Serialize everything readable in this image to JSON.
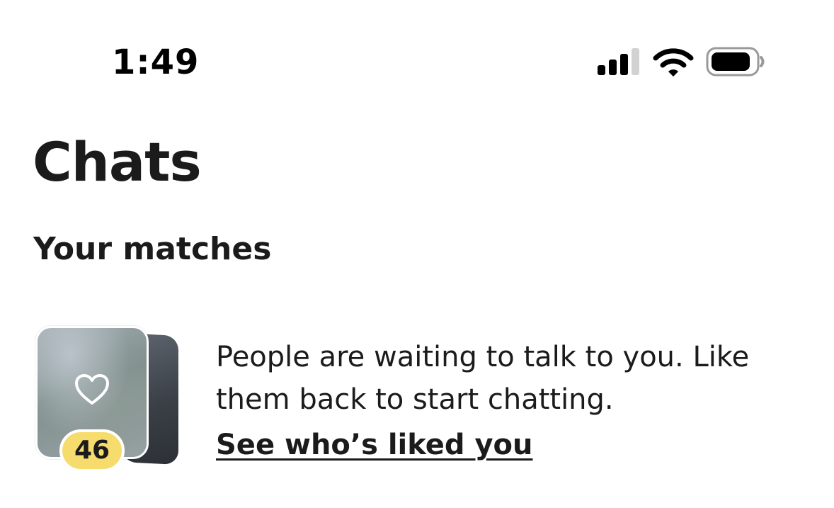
{
  "status_bar": {
    "time": "1:49",
    "signal_bars_filled": 3,
    "signal_bars_total": 4,
    "wifi": "wifi-icon",
    "battery": "battery-icon"
  },
  "page": {
    "title": "Chats"
  },
  "matches": {
    "section_title": "Your matches",
    "likes_count": "46",
    "message": "People are waiting to talk to you. Like them back to start chatting.",
    "link_label": "See who’s liked you",
    "icon": "heart-icon",
    "badge_color": "#f6dc6c"
  }
}
